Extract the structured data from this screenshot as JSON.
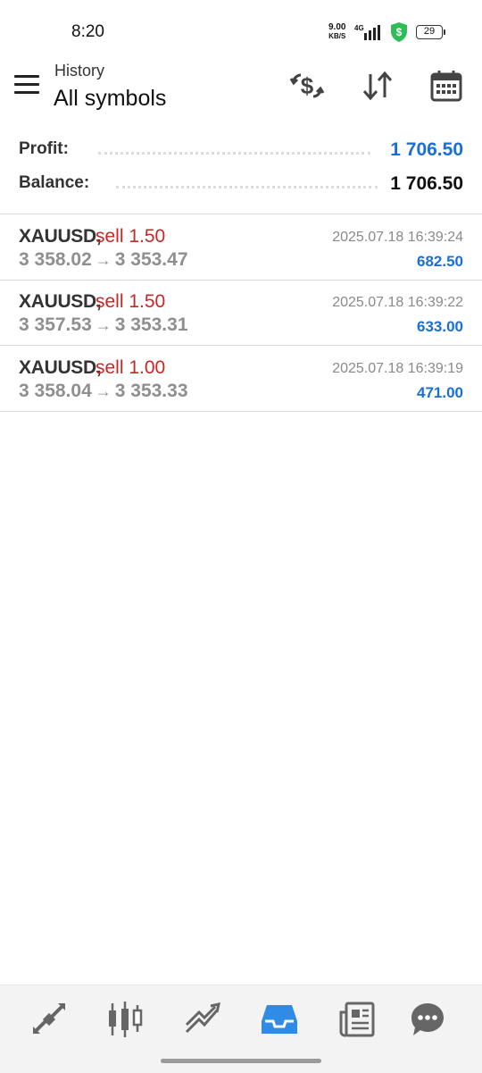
{
  "status_bar": {
    "time": "8:20",
    "net_speed": "9.00",
    "net_unit": "KB/S",
    "network": "4G",
    "battery": "29"
  },
  "header": {
    "subtitle": "History",
    "title": "All symbols",
    "icons": [
      "currency-exchange-icon",
      "sort-icon",
      "calendar-icon"
    ]
  },
  "summary": {
    "profit_label": "Profit:",
    "profit_value": "1 706.50",
    "balance_label": "Balance:",
    "balance_value": "1 706.50"
  },
  "deals": [
    {
      "symbol": "XAUUSD,",
      "side": "sell 1.50",
      "time": "2025.07.18 16:39:24",
      "open": "3 358.02",
      "arrow": "→",
      "close": "3 353.47",
      "profit": "682.50"
    },
    {
      "symbol": "XAUUSD,",
      "side": "sell 1.50",
      "time": "2025.07.18 16:39:22",
      "open": "3 357.53",
      "arrow": "→",
      "close": "3 353.31",
      "profit": "633.00"
    },
    {
      "symbol": "XAUUSD,",
      "side": "sell 1.00",
      "time": "2025.07.18 16:39:19",
      "open": "3 358.04",
      "arrow": "→",
      "close": "3 353.33",
      "profit": "471.00"
    }
  ],
  "bottom_nav": {
    "items": [
      "quotes-icon",
      "chart-icon",
      "trade-icon",
      "history-icon",
      "news-icon",
      "chat-icon"
    ],
    "active": "history-icon"
  },
  "colors": {
    "accent_blue": "#1a6fd6",
    "sell_red": "#c62828",
    "nav_active": "#2f8be6",
    "nav_inactive": "#666666"
  }
}
